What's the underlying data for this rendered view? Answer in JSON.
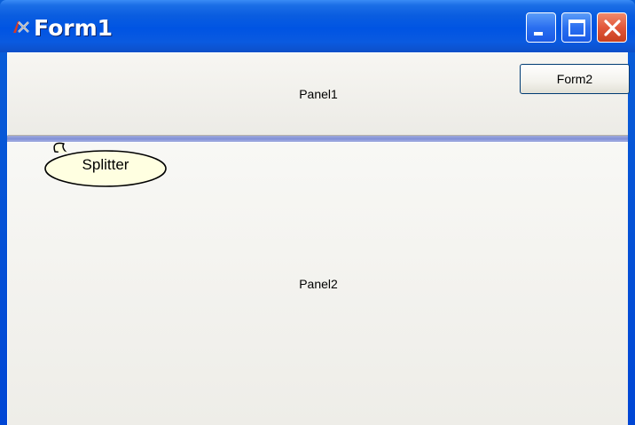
{
  "window": {
    "title": "Form1",
    "icon": "lazarus-icon",
    "controls": {
      "minimize_icon": "minimize-icon",
      "maximize_icon": "maximize-icon",
      "close_icon": "close-icon"
    }
  },
  "panel1": {
    "label": "Panel1",
    "button_label": "Form2"
  },
  "panel2": {
    "label": "Panel2"
  },
  "annotation": {
    "splitter_label": "Splitter"
  },
  "colors": {
    "titlebar": "#0054e3",
    "splitter": "#8090d8",
    "close_button": "#e2573a",
    "callout_fill": "#ffffe1"
  }
}
